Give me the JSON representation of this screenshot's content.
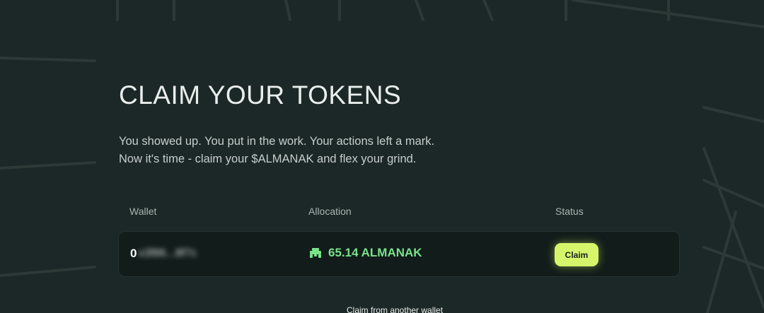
{
  "header": {
    "title": "CLAIM YOUR TOKENS",
    "subtitle_line1": "You showed up. You put in the work. Your actions left a mark.",
    "subtitle_line2": "Now it's time - claim your $ALMANAK and flex your grind."
  },
  "table": {
    "columns": [
      "Wallet",
      "Allocation",
      "Status"
    ],
    "rows": [
      {
        "wallet_first_char": "0",
        "wallet_rest_obscured": "x3f86...8f7c",
        "allocation": "65.14 ALMANAK",
        "status_button": "Claim"
      }
    ]
  },
  "footer": {
    "another_wallet_link": "Claim from another wallet"
  },
  "colors": {
    "background": "#1c2827",
    "accent": "#d6f56a",
    "allocation_green": "#79e28a"
  },
  "icons": {
    "allocation": "almanak-token-icon"
  }
}
